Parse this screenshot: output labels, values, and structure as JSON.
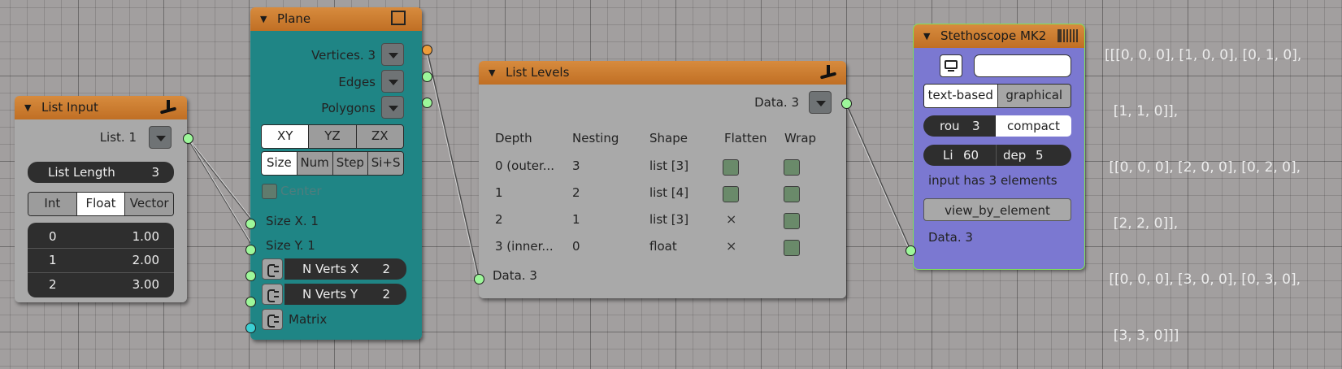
{
  "list_input": {
    "title": "List Input",
    "out_socket": "List. 1",
    "list_length_label": "List Length",
    "list_length_value": "3",
    "modes": [
      "Int",
      "Float",
      "Vector"
    ],
    "active_mode": "Float",
    "rows": [
      {
        "index": "0",
        "value": "1.00"
      },
      {
        "index": "1",
        "value": "2.00"
      },
      {
        "index": "2",
        "value": "3.00"
      }
    ]
  },
  "plane": {
    "title": "Plane",
    "outputs": [
      "Vertices. 3",
      "Edges",
      "Polygons"
    ],
    "planes": [
      "XY",
      "YZ",
      "ZX"
    ],
    "active_plane": "XY",
    "dims": [
      "Size",
      "Num",
      "Step",
      "Si+S"
    ],
    "active_dim": "Size",
    "center_label": "Center",
    "inputs": [
      "Size X. 1",
      "Size Y. 1"
    ],
    "nverts_x_label": "N Verts X",
    "nverts_x_value": "2",
    "nverts_y_label": "N Verts Y",
    "nverts_y_value": "2",
    "matrix_label": "Matrix"
  },
  "list_levels": {
    "title": "List Levels",
    "out_socket": "Data. 3",
    "in_socket": "Data. 3",
    "headers": [
      "Depth",
      "Nesting",
      "Shape",
      "Flatten",
      "Wrap"
    ],
    "rows": [
      {
        "depth": "0 (outer...",
        "nesting": "3",
        "shape": "list [3]",
        "flatten": "checkbox",
        "wrap": "checkbox"
      },
      {
        "depth": "1",
        "nesting": "2",
        "shape": "list [4]",
        "flatten": "checkbox",
        "wrap": "checkbox"
      },
      {
        "depth": "2",
        "nesting": "1",
        "shape": "list [3]",
        "flatten": "×",
        "wrap": "checkbox"
      },
      {
        "depth": "3 (inner...",
        "nesting": "0",
        "shape": "float",
        "flatten": "×",
        "wrap": "checkbox"
      }
    ]
  },
  "stethoscope": {
    "title": "Stethoscope MK2",
    "text_field": "",
    "modes": [
      "text-based",
      "graphical"
    ],
    "active_mode": "text-based",
    "round_label": "rou",
    "round_value": "3",
    "compact_label": "compact",
    "li_label": "Li",
    "li_value": "60",
    "dep_label": "dep",
    "dep_value": "5",
    "info_text": "input has 3 elements",
    "view_button": "view_by_element",
    "in_socket": "Data. 3"
  },
  "output_text": [
    "[[[0, 0, 0], [1, 0, 0], [0, 1, 0],",
    "  [1, 1, 0]],",
    " [[0, 0, 0], [2, 0, 0], [0, 2, 0],",
    "  [2, 2, 0]],",
    " [[0, 0, 0], [3, 0, 0], [0, 3, 0],",
    "  [3, 3, 0]]]"
  ],
  "colors": {
    "header_orange": "#c97a2f",
    "plane_teal": "#1f8585",
    "steth_violet": "#7b78d1",
    "socket_green": "#9df79a",
    "socket_orange": "#ed9c3a",
    "socket_cyan": "#3ccfd3"
  }
}
